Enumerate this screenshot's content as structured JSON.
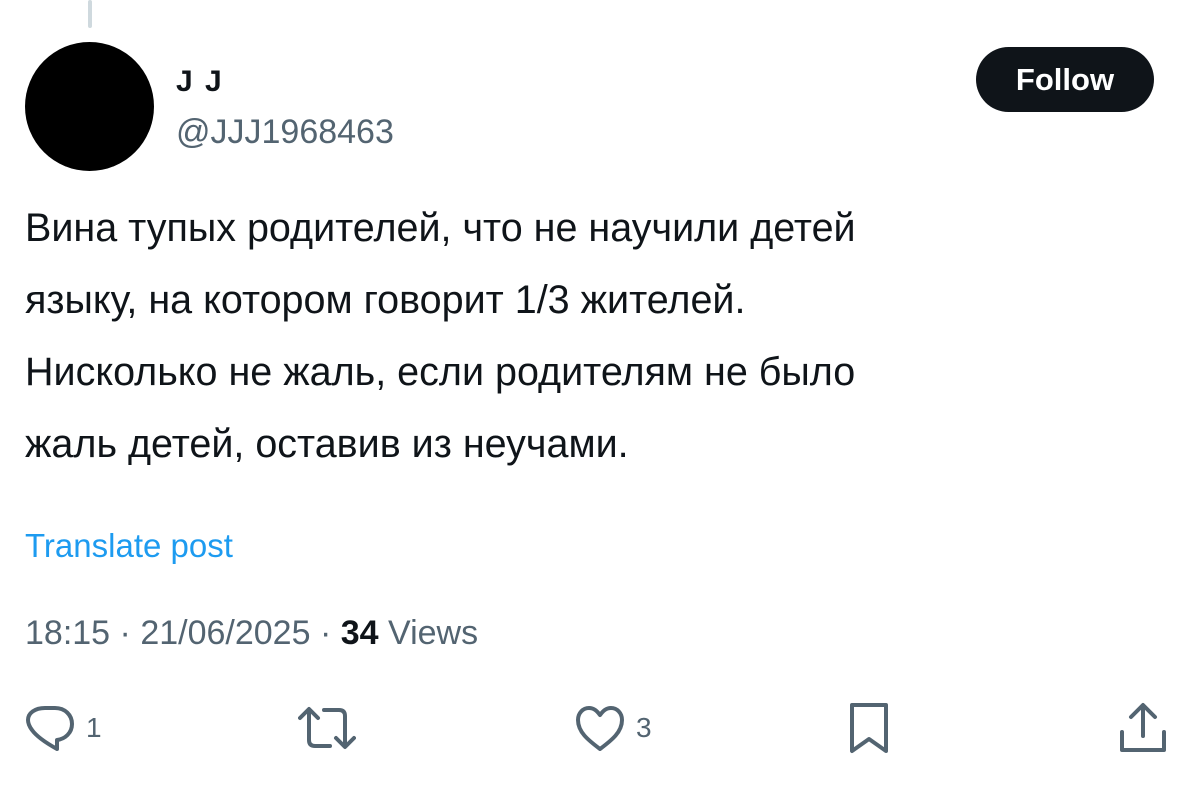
{
  "author": {
    "display_name": "J J",
    "handle": "@JJJ1968463"
  },
  "follow_label": "Follow",
  "post": {
    "text_lines": [
      "Вина тупых родителей, что не научили детей",
      "языку, на котором говорит 1/3 жителей.",
      "Нисколько не жаль, если родителям не было",
      "жаль детей, оставив из неучами."
    ],
    "translate_label": "Translate post",
    "time": "18:15",
    "separator": "·",
    "date": "21/06/2025",
    "views_count": "34",
    "views_label": "Views"
  },
  "actions": {
    "replies_count": "1",
    "likes_count": "3",
    "icons": [
      "reply-icon",
      "repost-icon",
      "like-icon",
      "bookmark-icon",
      "share-icon"
    ]
  },
  "colors": {
    "text": "#0f1419",
    "secondary": "#536471",
    "link": "#1d9bf0",
    "button_bg": "#0f1419"
  }
}
